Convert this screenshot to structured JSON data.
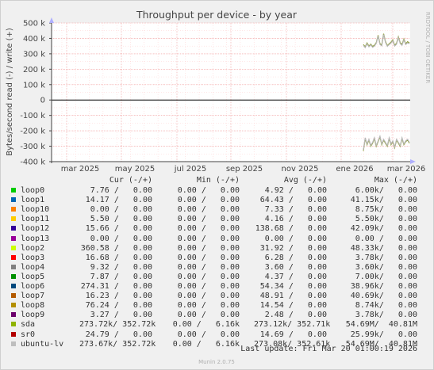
{
  "chart_data": {
    "type": "line",
    "title": "Throughput per device - by year",
    "ylabel": "Bytes/second read (-) / write (+)",
    "side_label": "RRDTOOL / TOBI OETIKER",
    "footer": "Munin 2.0.75",
    "ylim": [
      -400000,
      500000
    ],
    "yticks": [
      {
        "v": 500000,
        "label": "500 k"
      },
      {
        "v": 400000,
        "label": "400 k"
      },
      {
        "v": 300000,
        "label": "300 k"
      },
      {
        "v": 200000,
        "label": "200 k"
      },
      {
        "v": 100000,
        "label": "100 k"
      },
      {
        "v": 0,
        "label": "0"
      },
      {
        "v": -100000,
        "label": "-100 k"
      },
      {
        "v": -200000,
        "label": "-200 k"
      },
      {
        "v": -300000,
        "label": "-300 k"
      },
      {
        "v": -400000,
        "label": "-400 k"
      }
    ],
    "xticks": [
      "mar 2025",
      "may 2025",
      "jul 2025",
      "sep 2025",
      "nov 2025",
      "ene 2026",
      "mar 2026"
    ],
    "series": [
      {
        "name": "sda",
        "color": "#8a9a2a",
        "write": [
          360000,
          345000,
          370000,
          350000,
          362000,
          348000,
          355000,
          372000,
          420000,
          365000,
          358000,
          430000,
          380000,
          352000,
          365000,
          375000,
          390000,
          355000,
          368000,
          410000,
          372000,
          360000,
          395000,
          365000,
          378000,
          370000
        ],
        "read": [
          -330000,
          -250000,
          -290000,
          -260000,
          -300000,
          -280000,
          -250000,
          -300000,
          -270000,
          -240000,
          -290000,
          -260000,
          -280000,
          -300000,
          -250000,
          -290000,
          -270000,
          -310000,
          -260000,
          -280000,
          -300000,
          -250000,
          -290000,
          -270000,
          -260000,
          -280000
        ]
      },
      {
        "name": "ubuntu-lv",
        "color": "#b8b8b8",
        "write": [
          355000,
          340000,
          365000,
          345000,
          358000,
          342000,
          350000,
          368000,
          415000,
          360000,
          352000,
          425000,
          375000,
          348000,
          360000,
          370000,
          385000,
          350000,
          362000,
          405000,
          366000,
          355000,
          390000,
          360000,
          372000,
          365000
        ],
        "read": [
          -325000,
          -245000,
          -285000,
          -255000,
          -295000,
          -275000,
          -245000,
          -295000,
          -265000,
          -235000,
          -285000,
          -255000,
          -275000,
          -295000,
          -245000,
          -285000,
          -265000,
          -305000,
          -255000,
          -275000,
          -295000,
          -245000,
          -285000,
          -265000,
          -255000,
          -275000
        ]
      }
    ]
  },
  "legend": {
    "headers": {
      "cur": "Cur (-/+)",
      "min": "Min (-/+)",
      "avg": "Avg (-/+)",
      "max": "Max (-/+)"
    },
    "rows": [
      {
        "name": "loop0",
        "color": "#00cc00",
        "cur": "7.76 /   0.00",
        "min": "0.00 /   0.00",
        "avg": "4.92 /   0.00",
        "max": "6.00k/   0.00"
      },
      {
        "name": "loop1",
        "color": "#0066b3",
        "cur": "14.17 /   0.00",
        "min": "0.00 /   0.00",
        "avg": "64.43 /   0.00",
        "max": "41.15k/   0.00"
      },
      {
        "name": "loop10",
        "color": "#ff8000",
        "cur": "0.00 /   0.00",
        "min": "0.00 /   0.00",
        "avg": "7.33 /   0.00",
        "max": "8.75k/   0.00"
      },
      {
        "name": "loop11",
        "color": "#ffcc00",
        "cur": "5.50 /   0.00",
        "min": "0.00 /   0.00",
        "avg": "4.16 /   0.00",
        "max": "5.50k/   0.00"
      },
      {
        "name": "loop12",
        "color": "#330099",
        "cur": "15.66 /   0.00",
        "min": "0.00 /   0.00",
        "avg": "138.68 /   0.00",
        "max": "42.09k/   0.00"
      },
      {
        "name": "loop13",
        "color": "#990099",
        "cur": "0.00 /   0.00",
        "min": "0.00 /   0.00",
        "avg": "0.00 /   0.00",
        "max": "0.00 /   0.00"
      },
      {
        "name": "loop2",
        "color": "#ccff00",
        "cur": "360.58 /   0.00",
        "min": "0.00 /   0.00",
        "avg": "31.92 /   0.00",
        "max": "48.33k/   0.00"
      },
      {
        "name": "loop3",
        "color": "#ff0000",
        "cur": "16.68 /   0.00",
        "min": "0.00 /   0.00",
        "avg": "6.28 /   0.00",
        "max": "3.78k/   0.00"
      },
      {
        "name": "loop4",
        "color": "#808080",
        "cur": "9.32 /   0.00",
        "min": "0.00 /   0.00",
        "avg": "3.60 /   0.00",
        "max": "3.60k/   0.00"
      },
      {
        "name": "loop5",
        "color": "#008f00",
        "cur": "7.87 /   0.00",
        "min": "0.00 /   0.00",
        "avg": "4.37 /   0.00",
        "max": "7.00k/   0.00"
      },
      {
        "name": "loop6",
        "color": "#00487d",
        "cur": "274.31 /   0.00",
        "min": "0.00 /   0.00",
        "avg": "54.34 /   0.00",
        "max": "38.96k/   0.00"
      },
      {
        "name": "loop7",
        "color": "#b35a00",
        "cur": "16.23 /   0.00",
        "min": "0.00 /   0.00",
        "avg": "48.91 /   0.00",
        "max": "40.69k/   0.00"
      },
      {
        "name": "loop8",
        "color": "#b38f00",
        "cur": "76.24 /   0.00",
        "min": "0.00 /   0.00",
        "avg": "14.54 /   0.00",
        "max": "8.74k/   0.00"
      },
      {
        "name": "loop9",
        "color": "#6b006b",
        "cur": "3.27 /   0.00",
        "min": "0.00 /   0.00",
        "avg": "2.48 /   0.00",
        "max": "3.78k/   0.00"
      },
      {
        "name": "sda",
        "color": "#8fb300",
        "cur": "273.72k/ 352.72k",
        "min": "0.00 /   6.16k",
        "avg": "273.12k/ 352.71k",
        "max": "54.69M/  40.81M"
      },
      {
        "name": "sr0",
        "color": "#b30000",
        "cur": "24.79 /   0.00",
        "min": "0.00 /   0.00",
        "avg": "14.69 /   0.00",
        "max": "25.99k/   0.00"
      },
      {
        "name": "ubuntu-lv",
        "color": "#bebebe",
        "cur": "273.67k/ 352.72k",
        "min": "0.00 /   6.16k",
        "avg": "273.08k/ 352.61k",
        "max": "54.69M/  40.81M"
      }
    ],
    "last_update": "Last update: Fri Mar 20 01:00:19 2026"
  }
}
